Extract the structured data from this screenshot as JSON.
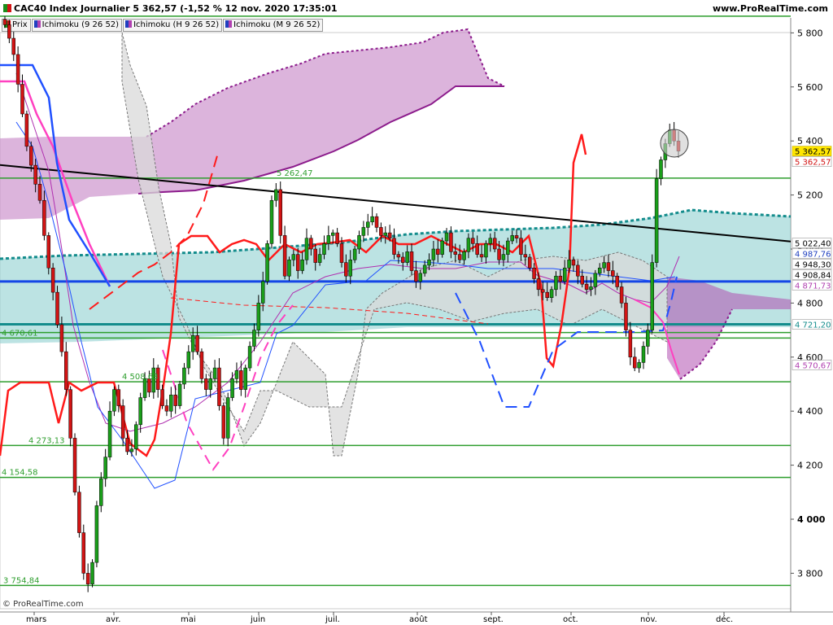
{
  "header": {
    "title": "CAC40 Index Journalier 5 362,57 (-1,52 % 12 nov. 2020 17:35:01",
    "site": "www.ProRealTime.com"
  },
  "legend": [
    {
      "label": "Prix",
      "color": "#1a8f1a"
    },
    {
      "label": "Ichimoku (9 26 52)",
      "color": "#b040b0"
    },
    {
      "label": "Ichimoku (H 9 26 52)",
      "color": "#b040b0"
    },
    {
      "label": "Ichimoku (M 9 26 52)",
      "color": "#2040c0"
    }
  ],
  "footer": {
    "copyright": "© ProRealTime.com"
  },
  "chart_data": {
    "type": "candlestick",
    "instrument": "CAC40",
    "last_price": 5362.57,
    "change_pct": -1.52,
    "y_axis": {
      "range": [
        3700,
        5870
      ],
      "ticks": [
        "3 800",
        "4 000",
        "4 200",
        "4 400",
        "4 600",
        "4 800",
        "5 000",
        "5 200",
        "5 400",
        "5 600",
        "5 800"
      ]
    },
    "x_axis": {
      "labels": [
        "mars",
        "avr.",
        "mai",
        "juin",
        "juil.",
        "août",
        "sept.",
        "oct.",
        "nov.",
        "déc."
      ]
    },
    "horizontal_levels": [
      {
        "value": 5862,
        "color": "#2e9e2e",
        "label": ""
      },
      {
        "value": 5262.47,
        "color": "#2e9e2e",
        "label": "5 262,47"
      },
      {
        "value": 4691,
        "color": "#2e9e2e",
        "label": ""
      },
      {
        "value": 4670.61,
        "color": "#2e9e2e",
        "label": "4 670,61"
      },
      {
        "value": 4508.63,
        "color": "#2e9e2e",
        "label": "4 508,63"
      },
      {
        "value": 4273.13,
        "color": "#2e9e2e",
        "label": "4 273,13"
      },
      {
        "value": 4154.58,
        "color": "#2e9e2e",
        "label": "4 154,58"
      },
      {
        "value": 3754.84,
        "color": "#2e9e2e",
        "label": "3 754,84"
      },
      {
        "value": 4880,
        "color": "#1446e6",
        "label": ""
      },
      {
        "value": 4721.2,
        "color": "#138c8c",
        "label": ""
      }
    ],
    "trendline": {
      "from": {
        "date": "2020-02-21",
        "value": 5311
      },
      "to": {
        "date": "2020-12-31",
        "value": 5028
      }
    },
    "price_labels": [
      {
        "value": 5362.57,
        "text": "5 362,57",
        "color": "#000000",
        "bg": "#ffe600"
      },
      {
        "value": 5362.57,
        "text": "5 362,57",
        "color": "#d21414",
        "bg": "#ffffff"
      },
      {
        "value": 5022.4,
        "text": "5 022,40",
        "color": "#000000",
        "bg": "#ffffff"
      },
      {
        "value": 4987.76,
        "text": "4 987,76",
        "color": "#2040c0",
        "bg": "#ffffff"
      },
      {
        "value": 4948.3,
        "text": "4 948,30",
        "color": "#000000",
        "bg": "#ffffff"
      },
      {
        "value": 4908.84,
        "text": "4 908,84",
        "color": "#000000",
        "bg": "#ffffff"
      },
      {
        "value": 4871.73,
        "text": "4 871,73",
        "color": "#b040b0",
        "bg": "#ffffff"
      },
      {
        "value": 4721.2,
        "text": "4 721,20",
        "color": "#138c8c",
        "bg": "#ffffff"
      },
      {
        "value": 4570.67,
        "text": "4 570,67",
        "color": "#b040b0",
        "bg": "#ffffff"
      }
    ],
    "candles_closes": [
      5830,
      5780,
      5720,
      5610,
      5500,
      5380,
      5310,
      5240,
      5180,
      5050,
      4930,
      4840,
      4720,
      4620,
      4480,
      4300,
      4100,
      3950,
      3800,
      3760,
      3840,
      4050,
      4150,
      4230,
      4400,
      4480,
      4420,
      4300,
      4250,
      4260,
      4350,
      4450,
      4520,
      4470,
      4560,
      4480,
      4420,
      4400,
      4460,
      4420,
      4500,
      4560,
      4620,
      4680,
      4620,
      4520,
      4480,
      4520,
      4560,
      4420,
      4300,
      4450,
      4520,
      4550,
      4480,
      4560,
      4640,
      4700,
      4800,
      4880,
      5020,
      5180,
      5220,
      5050,
      4900,
      4960,
      4980,
      4920,
      4960,
      5040,
      5000,
      4950,
      4980,
      5020,
      5050,
      5060,
      5020,
      4950,
      4900,
      4960,
      5000,
      5050,
      5080,
      5100,
      5120,
      5080,
      5050,
      5060,
      5040,
      4980,
      4970,
      4950,
      4990,
      4920,
      4880,
      4910,
      4940,
      4960,
      5000,
      4980,
      5030,
      5060,
      4990,
      4980,
      4960,
      4990,
      5040,
      5020,
      4980,
      4970,
      5020,
      5040,
      5000,
      4960,
      4980,
      5030,
      5050,
      5040,
      4980,
      4970,
      4930,
      4890,
      4850,
      4840,
      4820,
      4850,
      4900,
      4880,
      4930,
      4960,
      4940,
      4900,
      4870,
      4850,
      4860,
      4910,
      4930,
      4950,
      4920,
      4900,
      4860,
      4800,
      4700,
      4600,
      4560,
      4580,
      4640,
      4700,
      4950,
      5260,
      5330,
      5390,
      5440,
      5400,
      5362.57
    ]
  }
}
